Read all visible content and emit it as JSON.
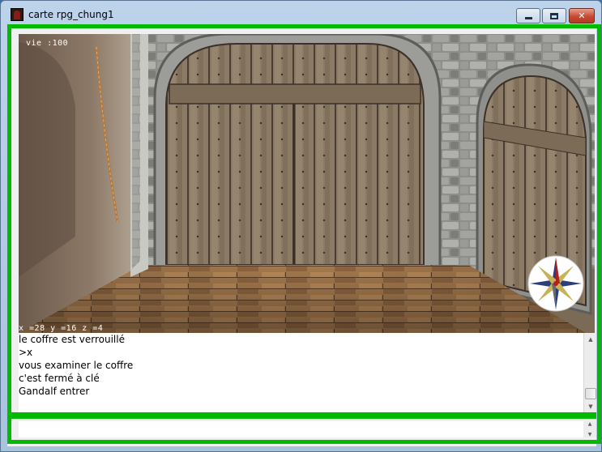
{
  "window": {
    "title": "carte rpg_chung1",
    "minimize_label": "",
    "maximize_label": "",
    "close_label": "✕"
  },
  "hud": {
    "life": "vie :100",
    "coords": "x =28 y =16 z =4"
  },
  "console": {
    "lines": [
      "le coffre est verrouillé",
      ">x",
      "vous examiner le coffre",
      "c'est fermé à clé",
      "Gandalf entrer"
    ]
  },
  "input": {
    "value": "",
    "placeholder": ""
  },
  "colors": {
    "frame_green": "#00bb00",
    "wood": "#7a6a56",
    "stone": "#8c8c88",
    "floor": "#a57a4e"
  },
  "icons": {
    "compass": "compass-rose-icon",
    "app": "dungeon-door-app-icon"
  }
}
